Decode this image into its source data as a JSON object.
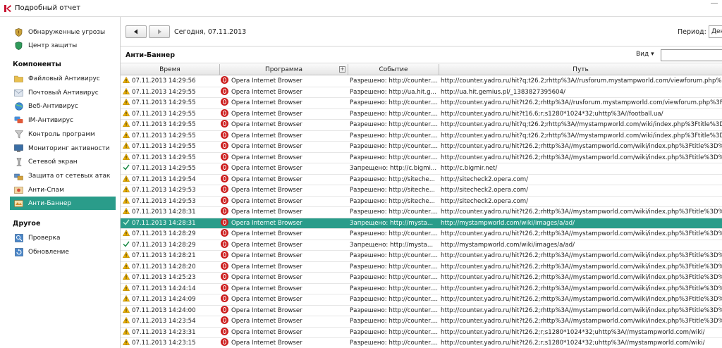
{
  "window": {
    "title": "Подробный отчет"
  },
  "sidebar": {
    "top_items": [
      {
        "label": "Обнаруженные угрозы",
        "icon": "shield-icon"
      },
      {
        "label": "Центр защиты",
        "icon": "shield-green-icon"
      }
    ],
    "components_header": "Компоненты",
    "components": [
      {
        "label": "Файловый Антивирус",
        "icon": "folder-icon"
      },
      {
        "label": "Почтовый Антивирус",
        "icon": "mail-icon"
      },
      {
        "label": "Веб-Антивирус",
        "icon": "globe-icon"
      },
      {
        "label": "IM-Антивирус",
        "icon": "chat-icon"
      },
      {
        "label": "Контроль программ",
        "icon": "filter-icon"
      },
      {
        "label": "Мониторинг активности",
        "icon": "monitor-icon"
      },
      {
        "label": "Сетевой экран",
        "icon": "firewall-icon"
      },
      {
        "label": "Защита от сетевых атак",
        "icon": "network-icon"
      },
      {
        "label": "Анти-Спам",
        "icon": "antispam-icon"
      },
      {
        "label": "Анти-Баннер",
        "icon": "banner-icon",
        "active": true
      }
    ],
    "other_header": "Другое",
    "other": [
      {
        "label": "Проверка",
        "icon": "scan-icon"
      },
      {
        "label": "Обновление",
        "icon": "update-icon"
      }
    ]
  },
  "toolbar": {
    "date_label": "Сегодня, 07.11.2013",
    "period_label": "Период:",
    "period_value": "День"
  },
  "section": {
    "title": "Анти-Баннер",
    "view_label": "Вид ▾"
  },
  "table": {
    "columns": [
      "Время",
      "Программа",
      "Событие",
      "Путь"
    ],
    "program_column_toggle": "+",
    "rows": [
      {
        "status": "warn",
        "time": "07.11.2013 14:29:56",
        "program": "Opera Internet Browser",
        "event": "Разрешено: http://counter....",
        "path": "http://counter.yadro.ru/hit?q;t26.2;rhttp%3A//rusforum.mystampworld.com/viewforum.php%3"
      },
      {
        "status": "warn",
        "time": "07.11.2013 14:29:55",
        "program": "Opera Internet Browser",
        "event": "Разрешено: http://ua.hit.g...",
        "path": "http://ua.hit.gemius.pl/_1383827395604/"
      },
      {
        "status": "warn",
        "time": "07.11.2013 14:29:55",
        "program": "Opera Internet Browser",
        "event": "Разрешено: http://counter....",
        "path": "http://counter.yadro.ru/hit?t26.2;rhttp%3A//rusforum.mystampworld.com/viewforum.php%3Ff"
      },
      {
        "status": "warn",
        "time": "07.11.2013 14:29:55",
        "program": "Opera Internet Browser",
        "event": "Разрешено: http://counter....",
        "path": "http://counter.yadro.ru/hit?t16.6;r;s1280*1024*32;uhttp%3A//football.ua/"
      },
      {
        "status": "warn",
        "time": "07.11.2013 14:29:55",
        "program": "Opera Internet Browser",
        "event": "Разрешено: http://counter....",
        "path": "http://counter.yadro.ru/hit?q;t26.2;rhttp%3A//mystampworld.com/wiki/index.php%3Ftitle%3D"
      },
      {
        "status": "warn",
        "time": "07.11.2013 14:29:55",
        "program": "Opera Internet Browser",
        "event": "Разрешено: http://counter....",
        "path": "http://counter.yadro.ru/hit?q;t26.2;rhttp%3A//mystampworld.com/wiki/index.php%3Ftitle%3D"
      },
      {
        "status": "warn",
        "time": "07.11.2013 14:29:55",
        "program": "Opera Internet Browser",
        "event": "Разрешено: http://counter....",
        "path": "http://counter.yadro.ru/hit?t26.2;rhttp%3A//mystampworld.com/wiki/index.php%3Ftitle%3D%"
      },
      {
        "status": "warn",
        "time": "07.11.2013 14:29:55",
        "program": "Opera Internet Browser",
        "event": "Разрешено: http://counter....",
        "path": "http://counter.yadro.ru/hit?t26.2;rhttp%3A//mystampworld.com/wiki/index.php%3Ftitle%3D%"
      },
      {
        "status": "ok",
        "time": "07.11.2013 14:29:55",
        "program": "Opera Internet Browser",
        "event": "Запрещено: http://c.bigmi...",
        "path": "http://c.bigmir.net/"
      },
      {
        "status": "warn",
        "time": "07.11.2013 14:29:54",
        "program": "Opera Internet Browser",
        "event": "Разрешено: http://siteche...",
        "path": "http://sitecheck2.opera.com/"
      },
      {
        "status": "warn",
        "time": "07.11.2013 14:29:53",
        "program": "Opera Internet Browser",
        "event": "Разрешено: http://siteche...",
        "path": "http://sitecheck2.opera.com/"
      },
      {
        "status": "warn",
        "time": "07.11.2013 14:29:53",
        "program": "Opera Internet Browser",
        "event": "Разрешено: http://siteche...",
        "path": "http://sitecheck2.opera.com/"
      },
      {
        "status": "warn",
        "time": "07.11.2013 14:28:31",
        "program": "Opera Internet Browser",
        "event": "Разрешено: http://counter....",
        "path": "http://counter.yadro.ru/hit?t26.2;rhttp%3A//mystampworld.com/wiki/index.php%3Ftitle%3D%"
      },
      {
        "status": "ok",
        "selected": true,
        "time": "07.11.2013 14:28:31",
        "program": "Opera Internet Browser",
        "event": "Запрещено: http://mysta...",
        "path": "http://mystampworld.com/wiki/images/a/ad/"
      },
      {
        "status": "warn",
        "time": "07.11.2013 14:28:29",
        "program": "Opera Internet Browser",
        "event": "Разрешено: http://counter....",
        "path": "http://counter.yadro.ru/hit?t26.2;rhttp%3A//mystampworld.com/wiki/index.php%3Ftitle%3D%"
      },
      {
        "status": "ok",
        "time": "07.11.2013 14:28:29",
        "program": "Opera Internet Browser",
        "event": "Запрещено: http://mysta...",
        "path": "http://mystampworld.com/wiki/images/a/ad/"
      },
      {
        "status": "warn",
        "time": "07.11.2013 14:28:21",
        "program": "Opera Internet Browser",
        "event": "Разрешено: http://counter....",
        "path": "http://counter.yadro.ru/hit?t26.2;rhttp%3A//mystampworld.com/wiki/index.php%3Ftitle%3D%"
      },
      {
        "status": "warn",
        "time": "07.11.2013 14:28:20",
        "program": "Opera Internet Browser",
        "event": "Разрешено: http://counter....",
        "path": "http://counter.yadro.ru/hit?t26.2;rhttp%3A//mystampworld.com/wiki/index.php%3Ftitle%3D%"
      },
      {
        "status": "warn",
        "time": "07.11.2013 14:25:23",
        "program": "Opera Internet Browser",
        "event": "Разрешено: http://counter....",
        "path": "http://counter.yadro.ru/hit?t26.2;rhttp%3A//mystampworld.com/wiki/index.php%3Ftitle%3D%"
      },
      {
        "status": "warn",
        "time": "07.11.2013 14:24:14",
        "program": "Opera Internet Browser",
        "event": "Разрешено: http://counter....",
        "path": "http://counter.yadro.ru/hit?t26.2;rhttp%3A//mystampworld.com/wiki/index.php%3Ftitle%3D%"
      },
      {
        "status": "warn",
        "time": "07.11.2013 14:24:09",
        "program": "Opera Internet Browser",
        "event": "Разрешено: http://counter....",
        "path": "http://counter.yadro.ru/hit?t26.2;rhttp%3A//mystampworld.com/wiki/index.php%3Ftitle%3D%"
      },
      {
        "status": "warn",
        "time": "07.11.2013 14:24:00",
        "program": "Opera Internet Browser",
        "event": "Разрешено: http://counter....",
        "path": "http://counter.yadro.ru/hit?t26.2;rhttp%3A//mystampworld.com/wiki/index.php%3Ftitle%3D%"
      },
      {
        "status": "warn",
        "time": "07.11.2013 14:23:54",
        "program": "Opera Internet Browser",
        "event": "Разрешено: http://counter....",
        "path": "http://counter.yadro.ru/hit?t26.2;rhttp%3A//mystampworld.com/wiki/index.php%3Ftitle%3D%"
      },
      {
        "status": "warn",
        "time": "07.11.2013 14:23:31",
        "program": "Opera Internet Browser",
        "event": "Разрешено: http://counter....",
        "path": "http://counter.yadro.ru/hit?t26.2;r;s1280*1024*32;uhttp%3A//mystampworld.com/wiki/"
      },
      {
        "status": "warn",
        "time": "07.11.2013 14:23:15",
        "program": "Opera Internet Browser",
        "event": "Разрешено: http://counter....",
        "path": "http://counter.yadro.ru/hit?t26.2;r;s1280*1024*32;uhttp%3A//mystampworld.com/wiki/"
      }
    ]
  }
}
